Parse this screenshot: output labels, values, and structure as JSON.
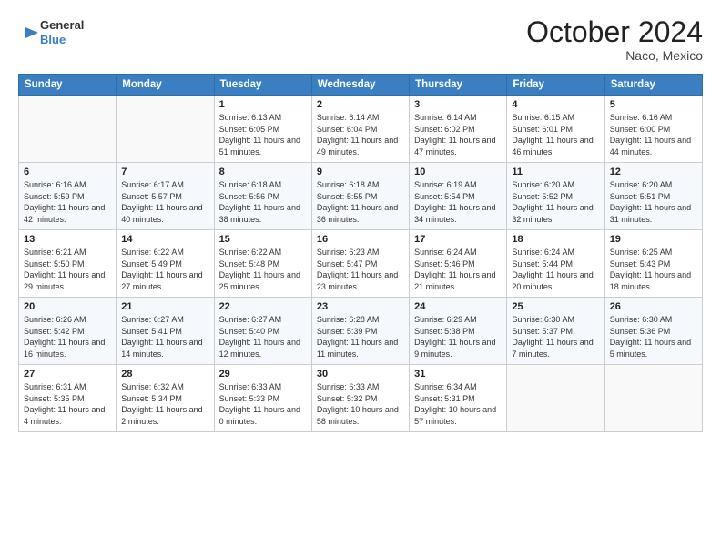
{
  "header": {
    "logo_line1": "General",
    "logo_line2": "Blue",
    "month": "October 2024",
    "location": "Naco, Mexico"
  },
  "weekdays": [
    "Sunday",
    "Monday",
    "Tuesday",
    "Wednesday",
    "Thursday",
    "Friday",
    "Saturday"
  ],
  "weeks": [
    [
      {
        "day": "",
        "info": ""
      },
      {
        "day": "",
        "info": ""
      },
      {
        "day": "1",
        "info": "Sunrise: 6:13 AM\nSunset: 6:05 PM\nDaylight: 11 hours and 51 minutes."
      },
      {
        "day": "2",
        "info": "Sunrise: 6:14 AM\nSunset: 6:04 PM\nDaylight: 11 hours and 49 minutes."
      },
      {
        "day": "3",
        "info": "Sunrise: 6:14 AM\nSunset: 6:02 PM\nDaylight: 11 hours and 47 minutes."
      },
      {
        "day": "4",
        "info": "Sunrise: 6:15 AM\nSunset: 6:01 PM\nDaylight: 11 hours and 46 minutes."
      },
      {
        "day": "5",
        "info": "Sunrise: 6:16 AM\nSunset: 6:00 PM\nDaylight: 11 hours and 44 minutes."
      }
    ],
    [
      {
        "day": "6",
        "info": "Sunrise: 6:16 AM\nSunset: 5:59 PM\nDaylight: 11 hours and 42 minutes."
      },
      {
        "day": "7",
        "info": "Sunrise: 6:17 AM\nSunset: 5:57 PM\nDaylight: 11 hours and 40 minutes."
      },
      {
        "day": "8",
        "info": "Sunrise: 6:18 AM\nSunset: 5:56 PM\nDaylight: 11 hours and 38 minutes."
      },
      {
        "day": "9",
        "info": "Sunrise: 6:18 AM\nSunset: 5:55 PM\nDaylight: 11 hours and 36 minutes."
      },
      {
        "day": "10",
        "info": "Sunrise: 6:19 AM\nSunset: 5:54 PM\nDaylight: 11 hours and 34 minutes."
      },
      {
        "day": "11",
        "info": "Sunrise: 6:20 AM\nSunset: 5:52 PM\nDaylight: 11 hours and 32 minutes."
      },
      {
        "day": "12",
        "info": "Sunrise: 6:20 AM\nSunset: 5:51 PM\nDaylight: 11 hours and 31 minutes."
      }
    ],
    [
      {
        "day": "13",
        "info": "Sunrise: 6:21 AM\nSunset: 5:50 PM\nDaylight: 11 hours and 29 minutes."
      },
      {
        "day": "14",
        "info": "Sunrise: 6:22 AM\nSunset: 5:49 PM\nDaylight: 11 hours and 27 minutes."
      },
      {
        "day": "15",
        "info": "Sunrise: 6:22 AM\nSunset: 5:48 PM\nDaylight: 11 hours and 25 minutes."
      },
      {
        "day": "16",
        "info": "Sunrise: 6:23 AM\nSunset: 5:47 PM\nDaylight: 11 hours and 23 minutes."
      },
      {
        "day": "17",
        "info": "Sunrise: 6:24 AM\nSunset: 5:46 PM\nDaylight: 11 hours and 21 minutes."
      },
      {
        "day": "18",
        "info": "Sunrise: 6:24 AM\nSunset: 5:44 PM\nDaylight: 11 hours and 20 minutes."
      },
      {
        "day": "19",
        "info": "Sunrise: 6:25 AM\nSunset: 5:43 PM\nDaylight: 11 hours and 18 minutes."
      }
    ],
    [
      {
        "day": "20",
        "info": "Sunrise: 6:26 AM\nSunset: 5:42 PM\nDaylight: 11 hours and 16 minutes."
      },
      {
        "day": "21",
        "info": "Sunrise: 6:27 AM\nSunset: 5:41 PM\nDaylight: 11 hours and 14 minutes."
      },
      {
        "day": "22",
        "info": "Sunrise: 6:27 AM\nSunset: 5:40 PM\nDaylight: 11 hours and 12 minutes."
      },
      {
        "day": "23",
        "info": "Sunrise: 6:28 AM\nSunset: 5:39 PM\nDaylight: 11 hours and 11 minutes."
      },
      {
        "day": "24",
        "info": "Sunrise: 6:29 AM\nSunset: 5:38 PM\nDaylight: 11 hours and 9 minutes."
      },
      {
        "day": "25",
        "info": "Sunrise: 6:30 AM\nSunset: 5:37 PM\nDaylight: 11 hours and 7 minutes."
      },
      {
        "day": "26",
        "info": "Sunrise: 6:30 AM\nSunset: 5:36 PM\nDaylight: 11 hours and 5 minutes."
      }
    ],
    [
      {
        "day": "27",
        "info": "Sunrise: 6:31 AM\nSunset: 5:35 PM\nDaylight: 11 hours and 4 minutes."
      },
      {
        "day": "28",
        "info": "Sunrise: 6:32 AM\nSunset: 5:34 PM\nDaylight: 11 hours and 2 minutes."
      },
      {
        "day": "29",
        "info": "Sunrise: 6:33 AM\nSunset: 5:33 PM\nDaylight: 11 hours and 0 minutes."
      },
      {
        "day": "30",
        "info": "Sunrise: 6:33 AM\nSunset: 5:32 PM\nDaylight: 10 hours and 58 minutes."
      },
      {
        "day": "31",
        "info": "Sunrise: 6:34 AM\nSunset: 5:31 PM\nDaylight: 10 hours and 57 minutes."
      },
      {
        "day": "",
        "info": ""
      },
      {
        "day": "",
        "info": ""
      }
    ]
  ]
}
